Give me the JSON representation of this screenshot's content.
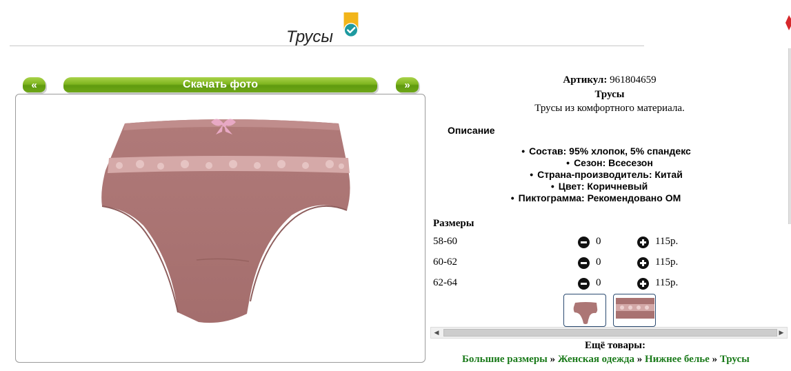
{
  "header": {
    "title": "Трусы",
    "badge_icon": "checkmark-badge-icon",
    "badge_colors": {
      "ribbon": "#f2b51a",
      "circle": "#1e9aa0"
    }
  },
  "gallery": {
    "prev_label": "«",
    "download_label": "Скачать фото",
    "next_label": "»",
    "button_color": "#6ea718"
  },
  "product": {
    "article_label": "Артикул:",
    "article_value": "961804659",
    "name": "Трусы",
    "short_description": "Трусы из комфортного материала.",
    "description_heading": "Описание",
    "properties": [
      "Состав: 95% хлопок, 5% спандекс",
      "Сезон: Всесезон",
      "Страна-производитель: Китай",
      "Цвет: Коричневый",
      "Пиктограмма: Рекомендовано ОМ"
    ]
  },
  "sizes": {
    "heading": "Размеры",
    "rows": [
      {
        "size": "58-60",
        "qty": "0",
        "price": "115р."
      },
      {
        "size": "60-62",
        "qty": "0",
        "price": "115р."
      },
      {
        "size": "62-64",
        "qty": "0",
        "price": "115р."
      }
    ]
  },
  "more": {
    "heading": "Ещё товары:",
    "breadcrumbs": [
      "Большие размеры",
      "Женская одежда",
      "Нижнее белье",
      "Трусы"
    ],
    "separator": "»",
    "link_color": "#1a7a1a"
  }
}
